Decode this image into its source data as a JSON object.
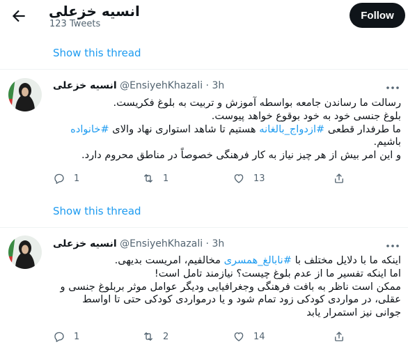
{
  "header": {
    "back_icon": "arrow-left-icon",
    "title": "انسیه خزعلی",
    "tweet_count": "123 Tweets",
    "follow_label": "Follow"
  },
  "threads": [
    {
      "show_thread_label": "Show this thread",
      "tweet": {
        "name": "انسیه خزعلی",
        "handle": "@EnsiyehKhazali",
        "separator": "·",
        "time": "3h",
        "lines": [
          [
            "رسالت ما رساندن جامعه بواسطه آموزش و تربیت به بلوغ فکریست."
          ],
          [
            "بلوغ جنسی خود به خود بوقوع خواهد پیوست."
          ],
          [
            "ما طرفدار قطعی ",
            "#ازدواج_بالغانه",
            " هستیم تا شاهد استواری نهاد والای ",
            "#خانواده"
          ],
          [
            "باشیم."
          ],
          [
            "و این امر بیش از هر چیز نیاز به کار فرهنگی خصوصاً در مناطق محروم دارد."
          ]
        ],
        "reply_count": "1",
        "retweet_count": "1",
        "like_count": "13"
      }
    },
    {
      "show_thread_label": "Show this thread",
      "tweet": {
        "name": "انسیه خزعلی",
        "handle": "@EnsiyehKhazali",
        "separator": "·",
        "time": "3h",
        "lines": [
          [
            "اینکه ما با دلایل مختلف با ",
            "#نابالغ_همسری",
            " مخالفیم، امریست بدیهی."
          ],
          [
            "اما اینکه تفسیر ما از عدم بلوغ چیست؟ نیازمند تامل است!"
          ],
          [
            "ممکن است ناظر به بافت فرهنگی وجغرافیایی ودیگر عوامل موثر بربلوغ جنسی و"
          ],
          [
            "عقلی، در مواردی کودکی زود تمام شود و یا درمواردی کودکی حتی تا اواسط"
          ],
          [
            "جوانی نیز استمرار یابد"
          ]
        ],
        "reply_count": "1",
        "retweet_count": "2",
        "like_count": "14"
      }
    }
  ],
  "icons": {
    "more": "more-dots-icon",
    "reply": "reply-bubble-icon",
    "retweet": "retweet-icon",
    "like": "heart-icon",
    "share": "share-icon"
  },
  "colors": {
    "accent": "#1d9bf0",
    "text": "#0f1419",
    "muted": "#536471",
    "divider": "#eff3f4",
    "follow_bg": "#0f1419"
  }
}
